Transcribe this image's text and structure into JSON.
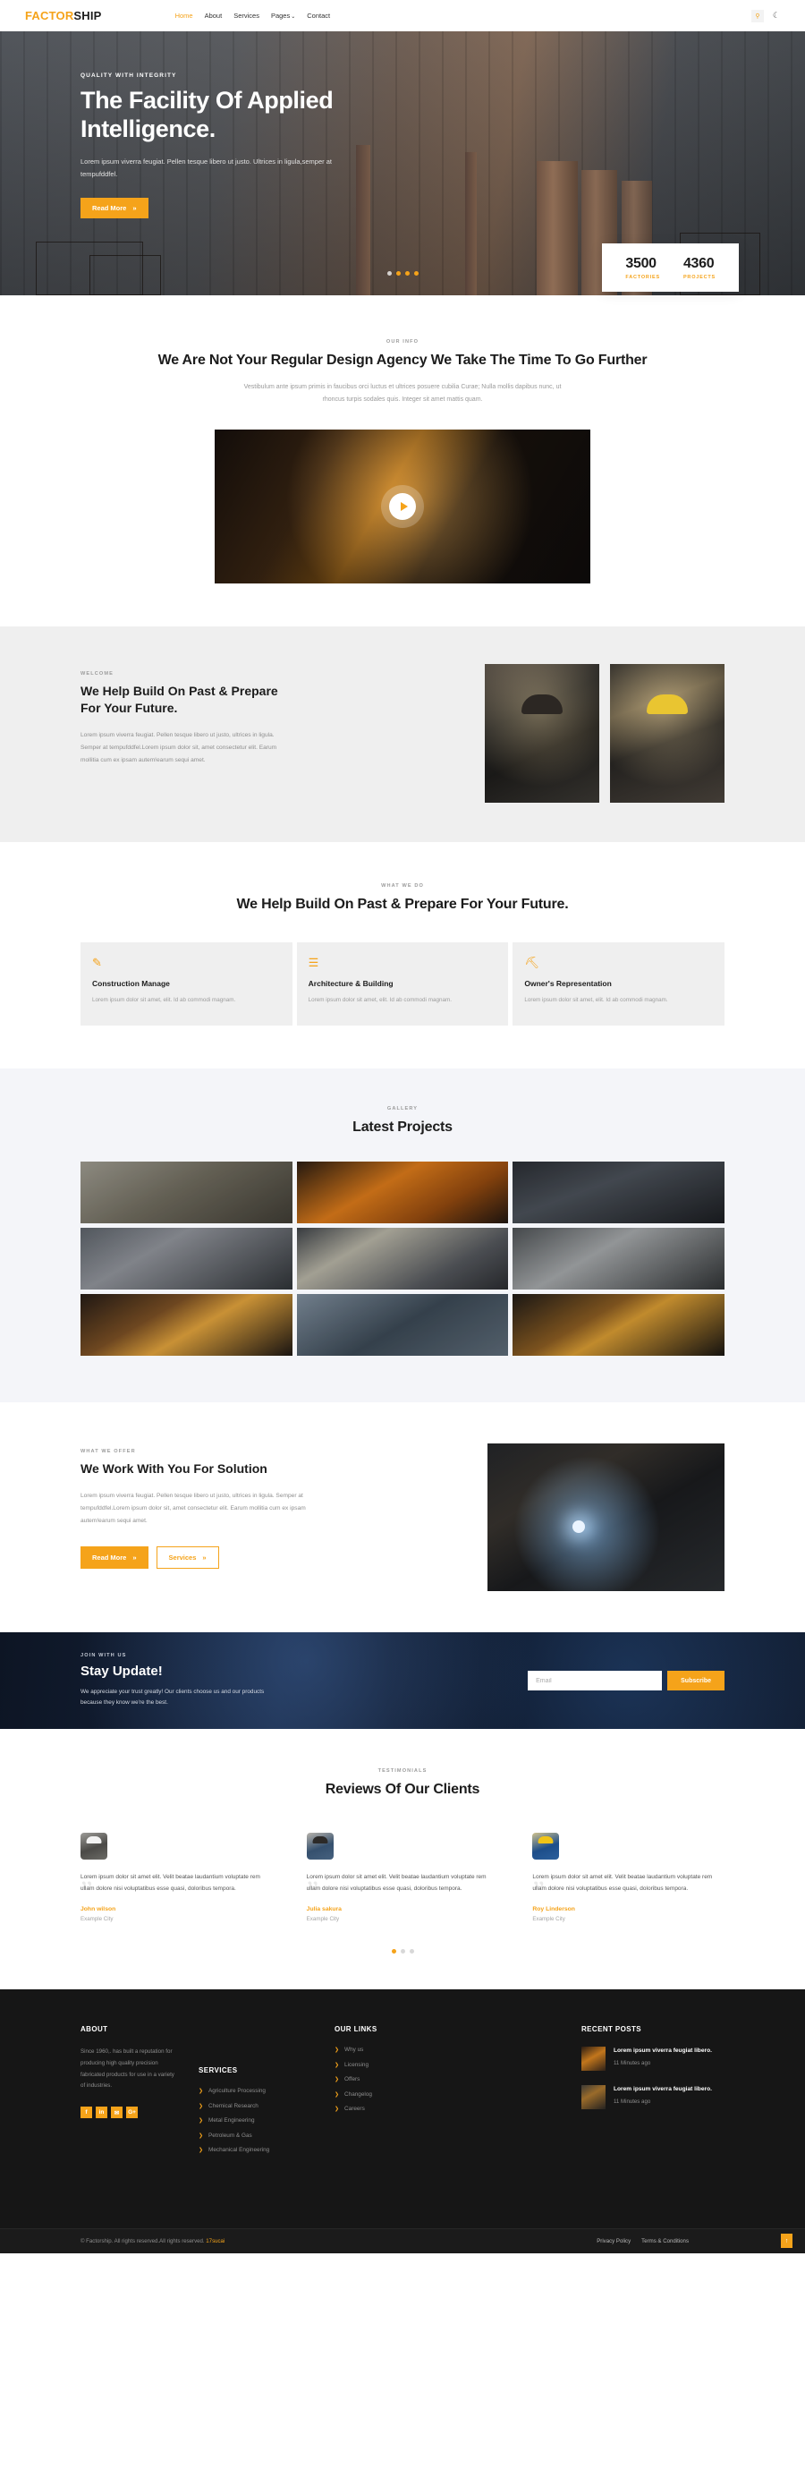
{
  "header": {
    "logo_part1": "FACTOR",
    "logo_part2": "SHIP",
    "nav": [
      {
        "label": "Home",
        "active": true
      },
      {
        "label": "About",
        "active": false
      },
      {
        "label": "Services",
        "active": false
      },
      {
        "label": "Pages",
        "active": false,
        "caret": "⌄"
      },
      {
        "label": "Contact",
        "active": false
      }
    ],
    "search_icon": "⚲",
    "theme_icon": "☾"
  },
  "hero": {
    "eyebrow": "QUALITY WITH INTEGRITY",
    "title": "The Facility Of Applied Intelligence.",
    "paragraph": "Lorem ipsum viverra feugiat. Pellen tesque libero ut justo. Ultrices in ligula,semper at tempufddfel.",
    "button": "Read More",
    "button_icon": "»",
    "dots": [
      false,
      true,
      true,
      true
    ]
  },
  "stats": [
    {
      "number": "3500",
      "label": "FACTORIES"
    },
    {
      "number": "4360",
      "label": "PROJECTS"
    }
  ],
  "intro": {
    "eyebrow": "OUR INFO",
    "title": "We Are Not Your Regular Design Agency We Take The Time To Go Further",
    "description": "Vestibulum ante ipsum primis in faucibus orci luctus et ultrices posuere cubilia Curae; Nulla mollis dapibus nunc, ut rhoncus turpis sodales quis. Integer sit amet mattis quam.",
    "play_label": "play-video"
  },
  "welcome": {
    "eyebrow": "WELCOME",
    "title": "We Help Build On Past & Prepare For Your Future.",
    "paragraph": "Lorem ipsum viverra feugiat. Pellen tesque libero ut justo, ultrices in ligula. Semper at tempufddfel.Lorem ipsum dolor sit, amet consectetur elit. Earum mollitia cum ex ipsam autem!earum sequi amet."
  },
  "services": {
    "eyebrow": "WHAT WE DO",
    "title": "We Help Build On Past & Prepare For Your Future.",
    "cards": [
      {
        "icon": "✎",
        "icon_name": "pencil-icon",
        "title": "Construction Manage",
        "text": "Lorem ipsum dolor sit amet, elit. Id ab commodi magnam."
      },
      {
        "icon": "☰",
        "icon_name": "layers-icon",
        "title": "Architecture & Building",
        "text": "Lorem ipsum dolor sit amet, elit. Id ab commodi magnam."
      },
      {
        "icon": "⛏",
        "icon_name": "crane-icon",
        "title": "Owner's Representation",
        "text": "Lorem ipsum dolor sit amet, elit. Id ab commodi magnam."
      }
    ]
  },
  "gallery": {
    "eyebrow": "GALLERY",
    "title": "Latest Projects",
    "items": [
      {
        "name": "warehouse-workers"
      },
      {
        "name": "molten-metal-pour"
      },
      {
        "name": "welder-sparks"
      },
      {
        "name": "factory-inspection"
      },
      {
        "name": "assembly-line"
      },
      {
        "name": "industrial-machinery"
      },
      {
        "name": "grinder-sparks"
      },
      {
        "name": "refinery-plant"
      },
      {
        "name": "welding-closeup"
      }
    ]
  },
  "offer": {
    "eyebrow": "WHAT WE OFFER",
    "title": "We Work With You For Solution",
    "paragraph": "Lorem ipsum viverra feugiat. Pellen tesque libero ut justo, ultrices in ligula. Semper at tempufddfel.Lorem ipsum dolor sit, amet consectetur elit. Earum mollitia cum ex ipsam autem!earum sequi amet.",
    "btn_primary": "Read More",
    "btn_secondary": "Services",
    "btn_icon": "»"
  },
  "newsletter": {
    "eyebrow": "JOIN WITH US",
    "title": "Stay Update!",
    "paragraph": "We appreciate your trust greatly! Our clients choose us and our products because they know we're the best.",
    "input_placeholder": "Email",
    "input_value": "",
    "button": "Subscribe"
  },
  "testimonials": {
    "eyebrow": "TESTIMONIALS",
    "title": "Reviews Of Our Clients",
    "quote_glyph": "”",
    "items": [
      {
        "text": "Lorem ipsum dolor sit amet elit. Velit beatae laudantium voluptate rem ullam dolore nisi voluptatibus esse quasi, doloribus tempora.",
        "name": "John wilson",
        "city": "Example City",
        "avatar": "worker-white-helmet"
      },
      {
        "text": "Lorem ipsum dolor sit amet elit. Velit beatae laudantium voluptate rem ullam dolore nisi voluptatibus esse quasi, doloribus tempora.",
        "name": "Julia sakura",
        "city": "Example City",
        "avatar": "worker-denim-jacket"
      },
      {
        "text": "Lorem ipsum dolor sit amet elit. Velit beatae laudantium voluptate rem ullam dolore nisi voluptatibus esse quasi, doloribus tempora.",
        "name": "Roy Linderson",
        "city": "Example City",
        "avatar": "worker-yellow-helmet"
      }
    ],
    "dots": [
      true,
      false,
      false
    ]
  },
  "footer": {
    "about": {
      "heading": "ABOUT",
      "text": "Since 1960,. has built a reputation for producing high quality precision fabricated products for use in a variety of industries.",
      "social": [
        {
          "glyph": "f",
          "name": "facebook-icon"
        },
        {
          "glyph": "in",
          "name": "linkedin-icon"
        },
        {
          "glyph": "✉",
          "name": "twitter-icon"
        },
        {
          "glyph": "G+",
          "name": "google-plus-icon"
        }
      ]
    },
    "services": {
      "heading": "SERVICES",
      "chevron": "❯",
      "items": [
        "Agriculture Processing",
        "Chemical Research",
        "Metal Engineering",
        "Petroleum & Gas",
        "Mechanical Engineering"
      ]
    },
    "links": {
      "heading": "OUR LINKS",
      "chevron": "❯",
      "items": [
        "Why us",
        "Licensing",
        "Offers",
        "Changelog",
        "Careers"
      ]
    },
    "posts": {
      "heading": "RECENT POSTS",
      "items": [
        {
          "title": "Lorem ipsum viverra feugiat libero.",
          "time": "11 Minutes ago"
        },
        {
          "title": "Lorem ipsum viverra feugiat libero.",
          "time": "11 Minutes ago"
        }
      ]
    },
    "bottom": {
      "copy_text": "© Factorship. All rights reserved.All rights reserved. ",
      "copy_link": "17sucai",
      "links": [
        "Privacy Policy",
        "Terms & Conditions"
      ],
      "to_top_icon": "↑"
    }
  },
  "colors": {
    "accent": "#f5a31a",
    "dark": "#161616",
    "light_gray": "#efefef",
    "gallery_bg": "#f4f5f9"
  }
}
